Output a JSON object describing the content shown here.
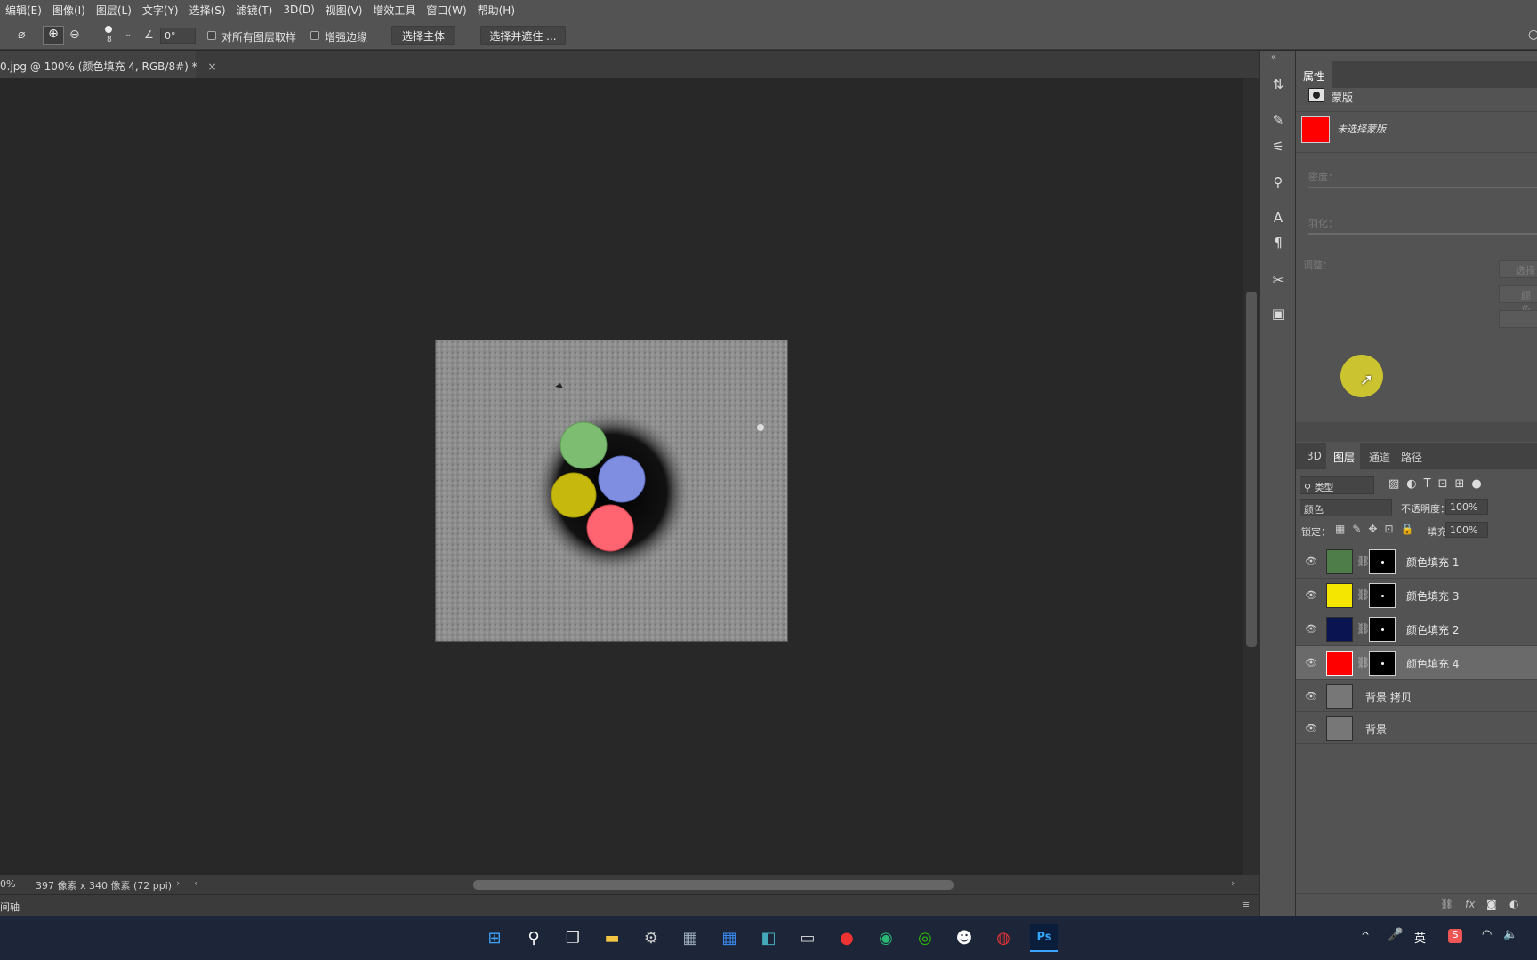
{
  "menu": [
    "编辑(E)",
    "图像(I)",
    "图层(L)",
    "文字(Y)",
    "选择(S)",
    "滤镜(T)",
    "3D(D)",
    "视图(V)",
    "增效工具",
    "窗口(W)",
    "帮助(H)"
  ],
  "options": {
    "brush_size": "8",
    "angle_value": "0°",
    "sample_all_layers": "对所有图层取样",
    "enhance_edge": "增强边缘",
    "select_subject": "选择主体",
    "select_and_mask": "选择并遮住 ..."
  },
  "document_tab": "0.jpg @ 100% (颜色填充 4, RGB/8#) *",
  "status_bar": {
    "zoom": "0%",
    "dimensions": "397 像素 x 340 像素 (72 ppi)"
  },
  "timeline_label": "间轴",
  "properties": {
    "tab": "属性",
    "section": "蒙版",
    "selected_mask": "未选择蒙版",
    "density_label": "密度：",
    "feather_label": "羽化：",
    "refine_label": "调整：",
    "btn_select": "选择",
    "btn_color": "颜色"
  },
  "layers_panel": {
    "tabs": [
      "3D",
      "图层",
      "通道",
      "路径"
    ],
    "filter_kind": "类型",
    "blend_mode": "颜色",
    "opacity_label": "不透明度：",
    "opacity_value": "100%",
    "lock_label": "锁定：",
    "fill_label": "填充：",
    "fill_value": "100%",
    "layers": [
      {
        "name": "颜色填充 1",
        "color": "#4f7d4a",
        "selected": false
      },
      {
        "name": "颜色填充 3",
        "color": "#f5e600",
        "selected": false
      },
      {
        "name": "颜色填充 2",
        "color": "#0a1450",
        "selected": false
      },
      {
        "name": "颜色填充 4",
        "color": "#ff0000",
        "selected": true
      },
      {
        "name": "背景 拷贝",
        "color": "#777777",
        "selected": false
      },
      {
        "name": "背景",
        "color": "#777777",
        "selected": false
      }
    ]
  },
  "taskbar": {
    "lang": "英",
    "sogou": "S"
  },
  "colors": {
    "panel_bg": "#535353",
    "canvas_bg": "#282828",
    "mask_red": "#ff0000",
    "cursor_highlight": "#d8cf2b"
  }
}
